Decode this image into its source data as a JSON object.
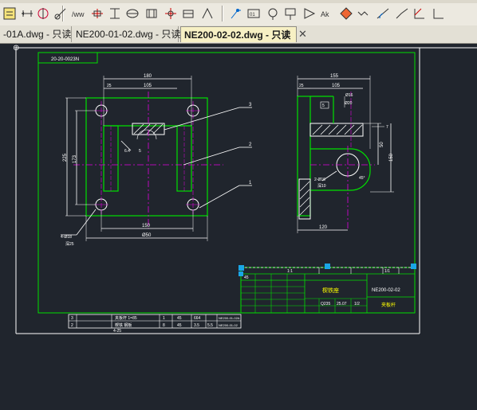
{
  "toolbar": {
    "icons": [
      "layer-icon",
      "dim-left-icon",
      "dim-center-icon",
      "radius-icon",
      "linear-dim-icon",
      "symmetry-icon",
      "baseline-icon",
      "align-icon",
      "ordinate-icon",
      "crosshair-icon",
      "table-icon",
      "arrow-icon",
      "leader-icon",
      "balloon-icon",
      "weld-icon",
      "tolerance-icon",
      "surface-icon",
      "datum-icon",
      "angle-icon",
      "chamfer-icon",
      "center-icon",
      "break-icon",
      "slope-icon",
      "axis-icon"
    ]
  },
  "tabs": [
    {
      "label": "-01A.dwg - 只读",
      "active": false
    },
    {
      "label": "NE200-01-02.dwg - 只读",
      "active": false
    },
    {
      "label": "NE200-02-02.dwg - 只读",
      "active": true
    }
  ],
  "tab_close": "✕",
  "drawing": {
    "frame_code": "20-20-0023N",
    "front_view": {
      "top_dim": "180",
      "top_sub_dim": "25",
      "mid_dim": "105",
      "left_dim_outer": "225",
      "left_dim_inner": "173",
      "bottom_dim_inner": "150",
      "bottom_dim_outer": "Ø50",
      "hole_note": "4-Ø18",
      "hole_note2": "深25",
      "center_note": "6.4",
      "center_note2": "5",
      "callout_1": "1",
      "callout_2": "2",
      "callout_3": "3"
    },
    "side_view": {
      "top_dim": "155",
      "top_sub_dim": "25",
      "mid_dim": "105",
      "right_dim_1": "50",
      "right_dim_2": "150",
      "right_dim_3": "7",
      "angle_note": "45°",
      "hole_note": "2-Ø16",
      "hole_note2": "深10",
      "bottom_dim": "120",
      "top_note": "5",
      "top_note2": "Ø16",
      "top_note3": "Ø20"
    },
    "title_block": {
      "drawing_no": "NE200-02-02",
      "part_name": "楔铁座",
      "part_name2": "夹板杆",
      "scale_label": "1:1",
      "sheet": "1/1",
      "material": "Q235",
      "weight": "25.07",
      "qty": "45",
      "total": "1/2"
    },
    "bom": {
      "rows": [
        {
          "no": "3",
          "name": "夹板杆 1=85",
          "qty": "1",
          "mat": "45",
          "w1": "664",
          "w2": "",
          "std": "NE200-01-02A"
        },
        {
          "no": "2",
          "name": "楔铁 钢板",
          "qty": "8",
          "mat": "45",
          "w1": "3.5",
          "w2": "5.5",
          "std": "NE200-01-02"
        }
      ],
      "sub_note": "4-25"
    }
  },
  "colors": {
    "green": "#00e000",
    "white": "#ffffff",
    "magenta": "#e000e0",
    "yellow": "#ffff00",
    "cyan": "#00e0ff"
  }
}
